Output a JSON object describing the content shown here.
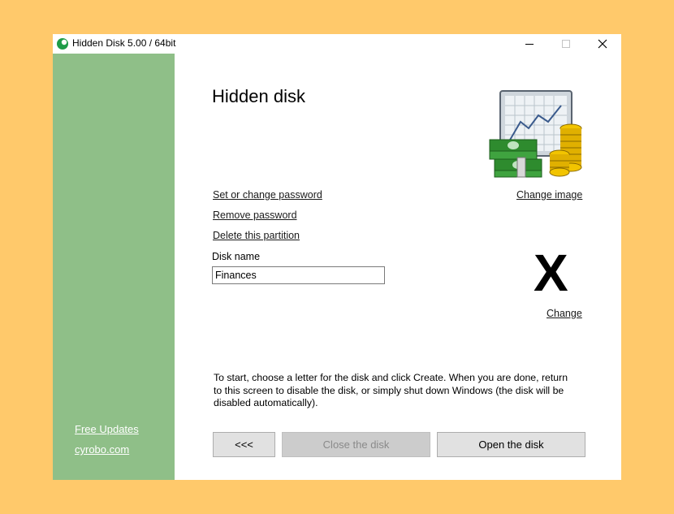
{
  "window": {
    "title": "Hidden Disk 5.00 / 64bit"
  },
  "sidebar": {
    "links": [
      {
        "label": "Free Updates"
      },
      {
        "label": "cyrobo.com"
      }
    ]
  },
  "main": {
    "heading": "Hidden disk",
    "links": {
      "set_password": "Set or change password",
      "remove_password": "Remove password",
      "delete_partition": "Delete this partition",
      "change_image": "Change image",
      "change_letter": "Change"
    },
    "disk_name_label": "Disk name",
    "disk_name_value": "Finances",
    "drive_letter": "X",
    "hint": "To start, choose a letter for the disk and click Create. When you are done, return to this screen to disable the disk, or simply shut down Windows (the disk will be disabled automatically).",
    "buttons": {
      "back": "<<<",
      "close_disk": "Close the disk",
      "open_disk": "Open the disk"
    }
  },
  "icons": {
    "app": "green-circle-app-icon",
    "minimize": "minimize-icon",
    "maximize": "maximize-icon",
    "close": "close-icon",
    "illustration": "chart-money-illustration"
  },
  "colors": {
    "background": "#FFC96B",
    "sidebar": "#8FBF88"
  }
}
